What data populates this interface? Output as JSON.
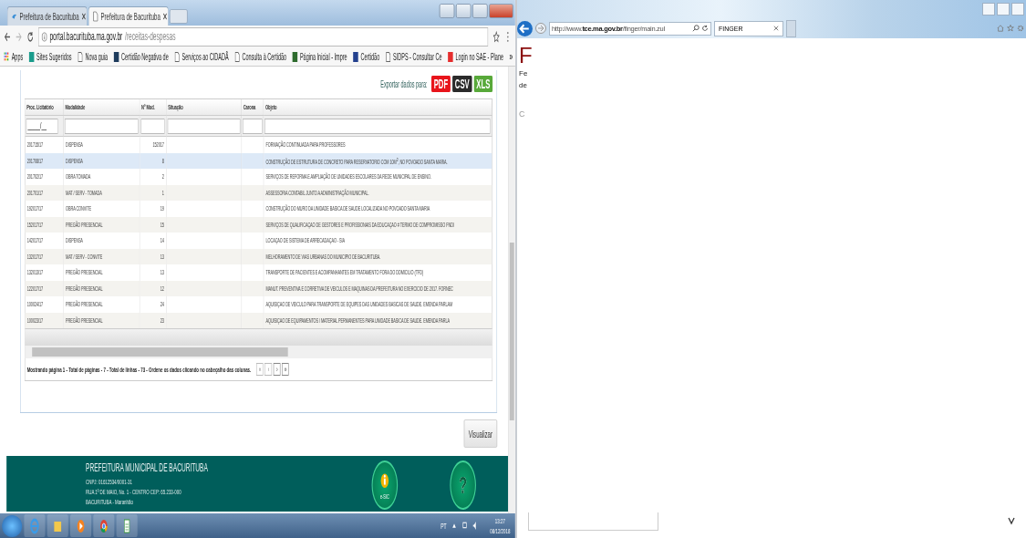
{
  "browser": {
    "tabs": [
      {
        "title": "Prefeitura de Bacurituba",
        "selected": false
      },
      {
        "title": "Prefeitura de Bacurituba",
        "selected": true
      }
    ],
    "address": {
      "host": "portal.bacurituba.ma.gov.br",
      "path": "/receitas-despesas"
    },
    "bookmarks": [
      {
        "label": "Apps",
        "kind": "apps"
      },
      {
        "label": "Sites Sugeridos",
        "kind": "site",
        "color": "#1a9c8c"
      },
      {
        "label": "Nova guia",
        "kind": "page"
      },
      {
        "label": "Certidão Negativa de",
        "kind": "site",
        "color": "#1d3b5c"
      },
      {
        "label": "Serviços ao CIDADÃ",
        "kind": "page"
      },
      {
        "label": "Consulta à Certidão",
        "kind": "page"
      },
      {
        "label": "Página Inicial - Impre",
        "kind": "site",
        "color": "#2e6b2e"
      },
      {
        "label": "Certidão",
        "kind": "site",
        "color": "#23408e"
      },
      {
        "label": "SIDPS - Consultar Ce",
        "kind": "page"
      },
      {
        "label": "Login no SAE - Plane",
        "kind": "site",
        "color": "#e52d2d"
      }
    ],
    "bookmarks_more": "»"
  },
  "page": {
    "export_label": "Exportar dados para:",
    "export_buttons": [
      {
        "label": "PDF",
        "color": "#e8141b"
      },
      {
        "label": "CSV",
        "color": "#2b2b2b"
      },
      {
        "label": "XLS",
        "color": "#58a93a"
      }
    ],
    "table": {
      "columns": [
        "Proc. Licitatório",
        "Modalidade",
        "Nº Mod.",
        "Situação",
        "Carona",
        "Objeto"
      ],
      "filter_mask": "_____/__",
      "rows": [
        {
          "proc": "201715/17",
          "modalidade": "DISPENSA",
          "n_mod": "152017",
          "objeto": "FORMAÇÃO CONTINUADA PARA PROFESSORES",
          "selected": false
        },
        {
          "proc": "201708/17",
          "modalidade": "DISPENSA",
          "n_mod": "8",
          "objeto": "CONSTRUÇÃO DE ESTRUTURA DE CONCRETO PARA RESERVATORIO COM 10M$^{3}$, NO POVOADO SANTA MARIA.",
          "selected": true
        },
        {
          "proc": "201702/17",
          "modalidade": "OBRA TOMADA",
          "n_mod": "2",
          "objeto": "SERVIÇOS DE REFORMA E AMPLIAÇÃO DE UNIDADES ESCOLARES DA REDE MUNICIPAL DE ENSINO.",
          "selected": false
        },
        {
          "proc": "201701/17",
          "modalidade": "MAT / SERV - TOMADA",
          "n_mod": "1",
          "objeto": "ASSESSORIA CONTABIL JUNTO A ADMINISTRAÇÃO MUNICIPAL.",
          "selected": false
        },
        {
          "proc": "192017/17",
          "modalidade": "OBRA CONVITE",
          "n_mod": "19",
          "objeto": "CONSTRUÇÃO DO MURO DA UNIDADE BASICA DE SAUDE LOCALIZADA NO POVOADO SANTA MARIA",
          "selected": false
        },
        {
          "proc": "152017/17",
          "modalidade": "PREGÃO PRESENCIAL",
          "n_mod": "15",
          "objeto": "SERVIÇOS DE QUALIFICAÇAO DE GESTORES E PROFISSIONAIS DA EDUCAÇAO # TERMO DE COMPROMISSO FNDI",
          "selected": false
        },
        {
          "proc": "142017/17",
          "modalidade": "DISPENSA",
          "n_mod": "14",
          "objeto": "LOCAÇAO DE SISTEMA DE ARRECADAÇAO - SIA",
          "selected": false
        },
        {
          "proc": "132017/17",
          "modalidade": "MAT / SERV - CONVITE",
          "n_mod": "13",
          "objeto": "MELHORAMENTO DE VIAS URBANAS DO MUNICIPIO DE BACURITUBA.",
          "selected": false
        },
        {
          "proc": "132013/17",
          "modalidade": "PREGÃO PRESENCIAL",
          "n_mod": "13",
          "objeto": "TRANSPORTE DE PACIENTES E ACOMPANHANTES EM TRATAMENTO FORA DO DOMICILIO (TFD)",
          "selected": false
        },
        {
          "proc": "122017/17",
          "modalidade": "PREGÃO PRESENCIAL",
          "n_mod": "12",
          "objeto": "MANUT. PREVENTIVA E CORRETIVA DE VEICULOS E MAQUINAS DA PREFEITURA NO EXERCICIO DE 2017. FORNEC",
          "selected": false
        },
        {
          "proc": "100024/17",
          "modalidade": "PREGÃO PRESENCIAL",
          "n_mod": "24",
          "objeto": "AQUISIÇAO DE VEICULO PARA TRANSPORTE DE EQUIPES DAS UNIDADES BASICAS DE SAUDE. EMENDA PARLAM",
          "selected": false
        },
        {
          "proc": "100023/17",
          "modalidade": "PREGÃO PRESENCIAL",
          "n_mod": "23",
          "objeto": "AQUISIÇAO DE EQUIPAMENTOS / MATERIAL PERMANENTES PARA UNIDADE BASICA DE SAUDE. EMENDA PARLA",
          "selected": false
        }
      ]
    },
    "pagination": {
      "text": "Mostrando página 1 - Total de páginas - 7 - Total de linhas - 73 - Ordene os dados clicando no cabeçalho das colunas.",
      "buttons": [
        {
          "label": "«",
          "disabled": true
        },
        {
          "label": "‹",
          "disabled": true
        },
        {
          "label": "›",
          "disabled": false
        },
        {
          "label": "»",
          "disabled": false
        }
      ]
    },
    "view_button": "Visualizar",
    "footer": {
      "title": "PREFEITURA MUNICIPAL DE BACURITUBA",
      "lines": [
        "CNPJ: 01612534/0001-31",
        "RUA 1º DE MAIO, No. 1 - CENTRO CEP: 65.233-000",
        "BACURITUBA - Maranhão"
      ],
      "esic_label": "e-SIC",
      "help_glyph": "?"
    }
  },
  "taskbar": {
    "language": "PT",
    "time": "13:27",
    "date": "08/12/2018"
  },
  "ie_window": {
    "address": "http://www.**tce.ma.gov.br**/finger/main.zul",
    "tab_title": "FINGER",
    "side_texts": [
      {
        "text": "F",
        "kind": "heading"
      },
      {
        "text": "Fe",
        "kind": "body"
      },
      {
        "text": "de",
        "kind": "body"
      },
      {
        "text": "C",
        "kind": "muted"
      }
    ]
  }
}
